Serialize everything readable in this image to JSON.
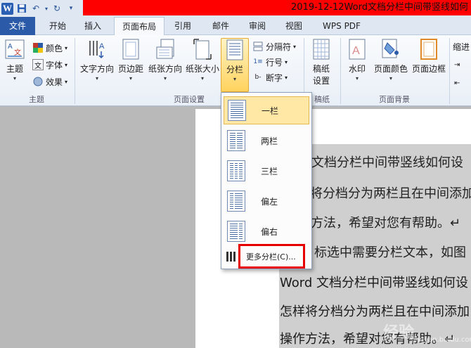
{
  "titlebar": {
    "doc_title": "2019-12-12Word文档分栏中间带竖线如何"
  },
  "tabs": [
    {
      "label": "文件"
    },
    {
      "label": "开始"
    },
    {
      "label": "插入"
    },
    {
      "label": "页面布局"
    },
    {
      "label": "引用"
    },
    {
      "label": "邮件"
    },
    {
      "label": "审阅"
    },
    {
      "label": "视图"
    },
    {
      "label": "WPS PDF"
    }
  ],
  "ribbon": {
    "theme_group": {
      "label": "主题",
      "theme_btn": "主题",
      "colors": "颜色",
      "fonts": "字体",
      "effects": "效果"
    },
    "page_setup_group": {
      "label": "页面设置",
      "text_direction": "文字方向",
      "margins": "页边距",
      "orientation": "纸张方向",
      "size": "纸张大小",
      "columns": "分栏",
      "breaks": "分隔符",
      "line_numbers": "行号",
      "hyphenation": "断字"
    },
    "manuscript_group": {
      "label": "稿纸",
      "manuscript_btn_line1": "稿纸",
      "manuscript_btn_line2": "设置"
    },
    "page_background_group": {
      "label": "页面背景",
      "watermark": "水印",
      "page_color": "页面颜色",
      "page_borders": "页面边框"
    },
    "indent_label": "缩进"
  },
  "columns_dropdown": {
    "items": [
      {
        "label": "一栏"
      },
      {
        "label": "两栏"
      },
      {
        "label": "三栏"
      },
      {
        "label": "偏左"
      },
      {
        "label": "偏右"
      }
    ],
    "more_label": "更多分栏(C)..."
  },
  "document": {
    "lines": [
      "文档分栏中间带竖线如何设",
      "将分档分为两栏且在中间添加",
      "方法，希望对您有帮助。↵",
      "标选中需要分栏文本，如图",
      "Word 文档分栏中间带竖线如何设",
      "怎样将分档分为两栏且在中间添加",
      "操作方法，希望对您有帮助。↵"
    ]
  },
  "watermark_text": "经验",
  "watermark_url": "jingyan.baidu.com"
}
